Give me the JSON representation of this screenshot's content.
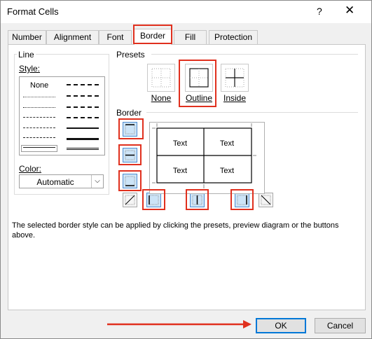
{
  "window": {
    "title": "Format Cells",
    "help_glyph": "?",
    "close_glyph": "✕"
  },
  "tabs": [
    {
      "label": "Number"
    },
    {
      "label": "Alignment"
    },
    {
      "label": "Font"
    },
    {
      "label": "Border",
      "active": true
    },
    {
      "label": "Fill"
    },
    {
      "label": "Protection"
    }
  ],
  "line": {
    "group_label": "Line",
    "style_label": "Style:",
    "none_label": "None",
    "color_label": "Color:",
    "color_value": "Automatic"
  },
  "presets": {
    "group_label": "Presets",
    "items": [
      {
        "label": "None"
      },
      {
        "label": "Outline"
      },
      {
        "label": "Inside"
      }
    ]
  },
  "border": {
    "group_label": "Border",
    "preview_cells": [
      "Text",
      "Text",
      "Text",
      "Text"
    ]
  },
  "description": "The selected border style can be applied by clicking the presets, preview diagram or the buttons above.",
  "buttons": {
    "ok": "OK",
    "cancel": "Cancel"
  },
  "colors": {
    "highlight": "#e0301e",
    "ok_border": "#0078d7",
    "selected_btn": "#cce4f7"
  }
}
